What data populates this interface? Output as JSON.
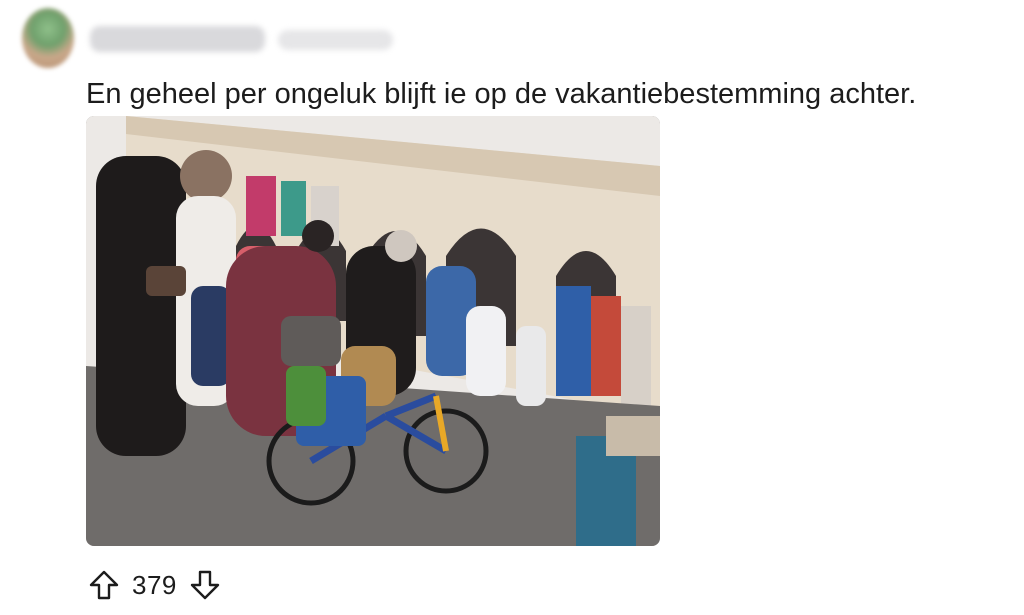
{
  "comment": {
    "text": "En geheel per ongeluk blijft ie op de vakantiebestemming achter.",
    "score": "379",
    "image_alt": "Street market photo with a bicycle"
  },
  "icons": {
    "upvote": "arrow-up-outline-icon",
    "downvote": "arrow-down-outline-icon"
  },
  "colors": {
    "text": "#1c1c1c",
    "background": "#ffffff"
  }
}
